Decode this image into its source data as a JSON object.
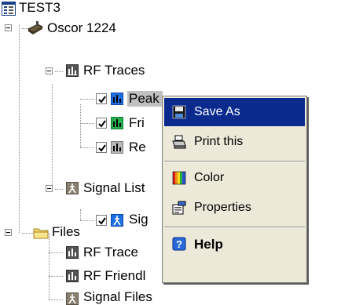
{
  "tree": {
    "root": "TEST3",
    "device": "Oscor 1224",
    "rf_traces": {
      "label": "RF Traces",
      "items": [
        "Peak",
        "Fri",
        "Re"
      ]
    },
    "signal_list": {
      "label": "Signal List",
      "items": [
        "Sig"
      ]
    },
    "files": {
      "label": "Files",
      "items": [
        "RF Trace",
        "RF Friendl",
        "Signal Files"
      ]
    }
  },
  "context_menu": {
    "items": [
      {
        "label": "Save As",
        "icon": "floppy-disk-icon",
        "selected": true
      },
      {
        "label": "Print this",
        "icon": "printer-icon"
      },
      {
        "label": "Color",
        "icon": "color-palette-icon"
      },
      {
        "label": "Properties",
        "icon": "properties-icon"
      },
      {
        "label": "Help",
        "icon": "help-icon"
      }
    ]
  },
  "colors": {
    "menu_highlight": "#0a2a8e",
    "menu_background": "#ece9d8"
  }
}
